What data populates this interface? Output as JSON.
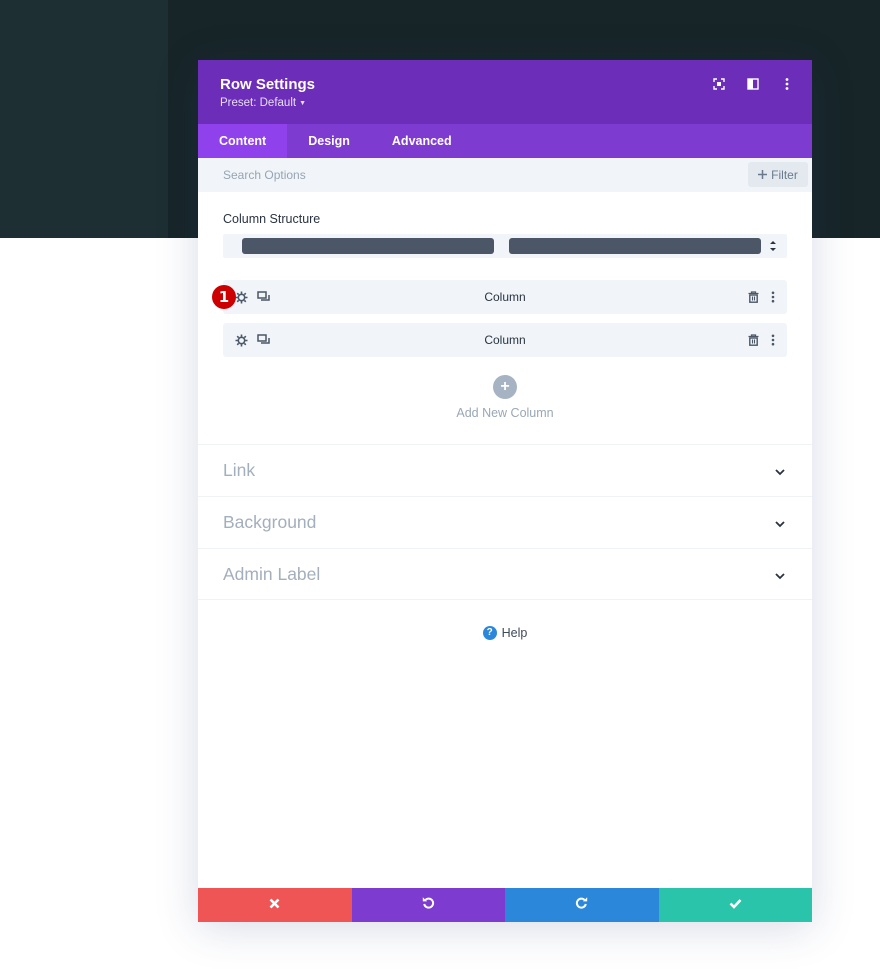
{
  "modal": {
    "title": "Row Settings",
    "preset_label": "Preset: Default",
    "header_icons": [
      "focus-icon",
      "split-view-icon",
      "more-vertical-icon"
    ]
  },
  "tabs": [
    {
      "label": "Content",
      "active": true
    },
    {
      "label": "Design",
      "active": false
    },
    {
      "label": "Advanced",
      "active": false
    }
  ],
  "search": {
    "placeholder": "Search Options",
    "filter_label": "Filter"
  },
  "column_structure": {
    "label": "Column Structure"
  },
  "columns": [
    {
      "label": "Column",
      "badge": "1"
    },
    {
      "label": "Column"
    }
  ],
  "add_column_label": "Add New Column",
  "accordion": [
    {
      "label": "Link"
    },
    {
      "label": "Background"
    },
    {
      "label": "Admin Label"
    }
  ],
  "help_label": "Help",
  "colors": {
    "header": "#6c2eb9",
    "tabs": "#7e3bd0",
    "tab_active": "#8f42ec",
    "cancel": "#ef5555",
    "undo": "#7e3bd0",
    "redo": "#2b87da",
    "save": "#29c4a9",
    "badge": "#cc0000"
  }
}
